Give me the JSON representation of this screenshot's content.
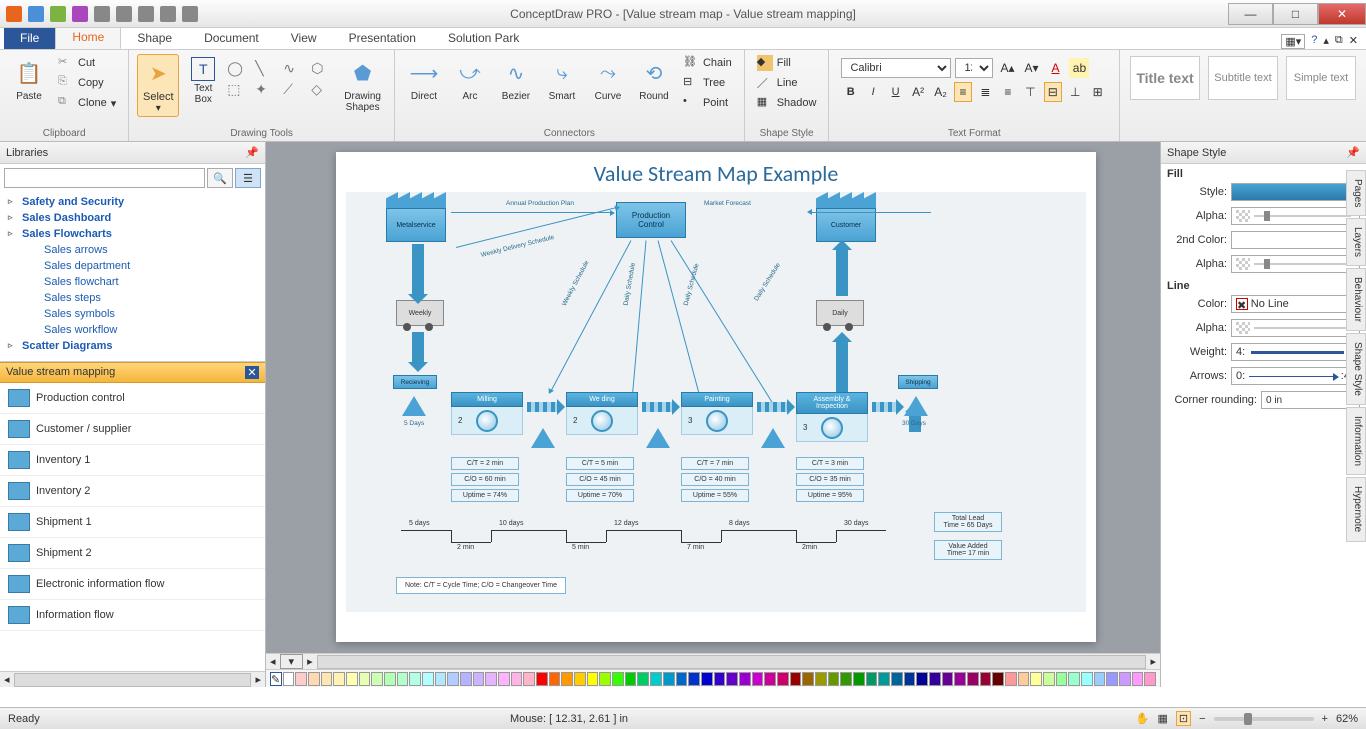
{
  "window": {
    "title": "ConceptDraw PRO - [Value stream map - Value stream mapping]"
  },
  "ribbon": {
    "file": "File",
    "tabs": [
      "Home",
      "Shape",
      "Document",
      "View",
      "Presentation",
      "Solution Park"
    ],
    "active_tab": "Home",
    "clipboard": {
      "paste": "Paste",
      "cut": "Cut",
      "copy": "Copy",
      "clone": "Clone",
      "label": "Clipboard"
    },
    "select": "Select",
    "textbox": "Text\nBox",
    "drawing_tools_label": "Drawing Tools",
    "drawing_shapes": "Drawing\nShapes",
    "connectors": {
      "direct": "Direct",
      "arc": "Arc",
      "bezier": "Bezier",
      "smart": "Smart",
      "curve": "Curve",
      "round": "Round",
      "chain": "Chain",
      "tree": "Tree",
      "point": "Point",
      "label": "Connectors"
    },
    "shape_style": {
      "fill": "Fill",
      "line": "Line",
      "shadow": "Shadow",
      "label": "Shape Style"
    },
    "font": {
      "name": "Calibri",
      "size": "12",
      "label": "Text Format"
    },
    "presets": {
      "title": "Title\ntext",
      "subtitle": "Subtitle\ntext",
      "simple": "Simple\ntext"
    }
  },
  "libraries": {
    "header": "Libraries",
    "tree": [
      {
        "label": "Safety and Security",
        "bold": true
      },
      {
        "label": "Sales Dashboard",
        "bold": true
      },
      {
        "label": "Sales Flowcharts",
        "bold": true
      },
      {
        "label": "Sales arrows",
        "child": true
      },
      {
        "label": "Sales department",
        "child": true
      },
      {
        "label": "Sales flowchart",
        "child": true
      },
      {
        "label": "Sales steps",
        "child": true
      },
      {
        "label": "Sales symbols",
        "child": true
      },
      {
        "label": "Sales workflow",
        "child": true
      },
      {
        "label": "Scatter Diagrams",
        "bold": true
      }
    ],
    "current_lib": "Value stream mapping",
    "shapes": [
      "Production control",
      "Customer / supplier",
      "Inventory 1",
      "Inventory 2",
      "Shipment 1",
      "Shipment 2",
      "Electronic information flow",
      "Information flow"
    ]
  },
  "canvas": {
    "title": "Value Stream Map Example",
    "prod_control": "Production\nControl",
    "metalservice": "Metalservice",
    "customer": "Customer",
    "annual": "Annual Production Plan",
    "forecast": "Market Forecast",
    "weekly_delivery": "Weekly Delivery Schedule",
    "weekly_sched": "Weekly Schedule",
    "daily_sched": "Daily Schedule",
    "truck_weekly": "Weekly",
    "truck_daily": "Daily",
    "recieving": "Recieving",
    "shipping": "Shipping",
    "days5": "5 Days",
    "days30": "30 Days",
    "processes": [
      {
        "name": "Milling",
        "n": "2",
        "ct": "C/T = 2 min",
        "co": "C/O = 60 min",
        "up": "Uptime = 74%"
      },
      {
        "name": "We ding",
        "n": "2",
        "ct": "C/T = 5 min",
        "co": "C/O = 45 min",
        "up": "Uptime = 70%"
      },
      {
        "name": "Painting",
        "n": "3",
        "ct": "C/T = 7 min",
        "co": "C/O = 40 min",
        "up": "Uptime = 55%"
      },
      {
        "name": "Assembly & Inspection",
        "n": "3",
        "ct": "C/T = 3 min",
        "co": "C/O = 35 min",
        "up": "Uptime = 95%"
      }
    ],
    "timeline_top": [
      "5 days",
      "10 days",
      "12 days",
      "8 days",
      "30 days"
    ],
    "timeline_bot": [
      "2 min",
      "5 min",
      "7 min",
      "2min"
    ],
    "total_lead": "Total Lead\nTime = 65 Days",
    "value_added": "Value Added\nTime= 17 min",
    "note": "Note: C/T = Cycle Time; C/O = Changeover Time"
  },
  "shape_style_panel": {
    "header": "Shape Style",
    "fill": "Fill",
    "style": "Style:",
    "alpha": "Alpha:",
    "second": "2nd Color:",
    "line": "Line",
    "color": "Color:",
    "noline": "No Line",
    "weight": "Weight:",
    "weight_val": "4:",
    "arrows": "Arrows:",
    "arrows_val": "0:",
    "arrows_end": ":4",
    "corner": "Corner rounding:",
    "corner_val": "0 in"
  },
  "side_tabs": [
    "Pages",
    "Layers",
    "Behaviour",
    "Shape Style",
    "Information",
    "Hypernote"
  ],
  "status": {
    "ready": "Ready",
    "mouse": "Mouse: [ 12.31, 2.61 ] in",
    "zoom": "62%"
  },
  "palette_colors": [
    "#fff",
    "#fecccb",
    "#fed9b3",
    "#fee6b3",
    "#fff2b3",
    "#ffffb3",
    "#e6ffb3",
    "#ccffb3",
    "#b3ffb3",
    "#b3ffcc",
    "#b3ffe6",
    "#b3ffff",
    "#b3e6ff",
    "#b3ccff",
    "#b3b3ff",
    "#ccb3ff",
    "#e6b3ff",
    "#ffb3ff",
    "#ffb3e6",
    "#ffb3cc",
    "#f00",
    "#f60",
    "#f90",
    "#fc0",
    "#ff0",
    "#9f0",
    "#3f0",
    "#0c0",
    "#0c6",
    "#0cc",
    "#09c",
    "#06c",
    "#03c",
    "#00c",
    "#30c",
    "#60c",
    "#90c",
    "#c0c",
    "#c09",
    "#c06",
    "#900",
    "#960",
    "#990",
    "#690",
    "#390",
    "#090",
    "#096",
    "#099",
    "#069",
    "#039",
    "#009",
    "#309",
    "#609",
    "#909",
    "#906",
    "#903",
    "#600",
    "#f99",
    "#fc9",
    "#ff9",
    "#cf9",
    "#9f9",
    "#9fc",
    "#9ff",
    "#9cf",
    "#99f",
    "#c9f",
    "#f9f",
    "#f9c"
  ]
}
